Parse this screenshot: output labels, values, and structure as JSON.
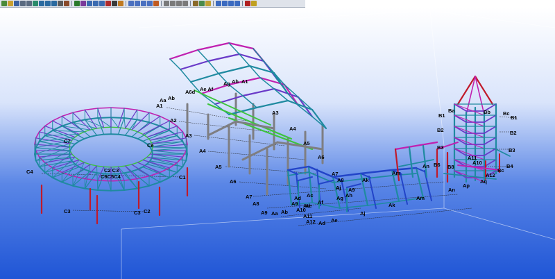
{
  "colors": {
    "bg_top": "#ffffff",
    "bg_bottom": "#1f55d6",
    "steel_teal": "#1f8aa0",
    "steel_magenta": "#c020b0",
    "steel_green": "#3cc43c",
    "steel_red": "#c01a2a",
    "steel_purple": "#6a3ac8",
    "steel_blue": "#2244c8",
    "column_gray": "#7e7e82",
    "gridline": "#1a1a1a"
  },
  "toolbar": {
    "buttons": [
      {
        "icon": "new-icon",
        "color": "#4a8a3a"
      },
      {
        "icon": "open-icon",
        "color": "#c9a030"
      },
      {
        "icon": "save-icon",
        "color": "#3a60a0"
      },
      {
        "icon": "undo-icon",
        "color": "#5a6a80"
      },
      {
        "icon": "redo-icon",
        "color": "#5a6a80"
      },
      {
        "icon": "grid-icon",
        "color": "#2a8a6a"
      },
      {
        "icon": "beam-icon",
        "color": "#2a6aa0"
      },
      {
        "icon": "column-icon",
        "color": "#2a6aa0"
      },
      {
        "icon": "plate-icon",
        "color": "#2a6aa0"
      },
      {
        "icon": "bolt-icon",
        "color": "#5a5a5a"
      },
      {
        "icon": "weld-icon",
        "color": "#8a4a2a"
      },
      {
        "icon": "separator",
        "color": ""
      },
      {
        "icon": "home-icon",
        "color": "#2a7a2a"
      },
      {
        "icon": "move-icon",
        "color": "#7a3a9a"
      },
      {
        "icon": "copy-icon",
        "color": "#3a6ab0"
      },
      {
        "icon": "rotate-icon",
        "color": "#3a6ab0"
      },
      {
        "icon": "mirror-icon",
        "color": "#3a6ab0"
      },
      {
        "icon": "delete-icon",
        "color": "#b02a2a"
      },
      {
        "icon": "select-icon",
        "color": "#3a3a3a"
      },
      {
        "icon": "measure-icon",
        "color": "#c07a20"
      },
      {
        "icon": "separator",
        "color": ""
      },
      {
        "icon": "view-icon",
        "color": "#4a70c0"
      },
      {
        "icon": "zoom-icon",
        "color": "#4a70c0"
      },
      {
        "icon": "pan-icon",
        "color": "#4a70c0"
      },
      {
        "icon": "fit-icon",
        "color": "#4a70c0"
      },
      {
        "icon": "render-icon",
        "color": "#c05a20"
      },
      {
        "icon": "separator",
        "color": ""
      },
      {
        "icon": "snap-icon",
        "color": "#7a7a7a"
      },
      {
        "icon": "point-icon",
        "color": "#7a7a7a"
      },
      {
        "icon": "line-icon",
        "color": "#7a7a7a"
      },
      {
        "icon": "arc-icon",
        "color": "#7a7a7a"
      },
      {
        "icon": "separator",
        "color": ""
      },
      {
        "icon": "link-icon",
        "color": "#8a6a2a"
      },
      {
        "icon": "layers-icon",
        "color": "#4a8a4a"
      },
      {
        "icon": "filter-icon",
        "color": "#c0a030"
      },
      {
        "icon": "separator",
        "color": ""
      },
      {
        "icon": "line-tool-icon",
        "color": "#3a6ac0"
      },
      {
        "icon": "polyline-icon",
        "color": "#3a6ac0"
      },
      {
        "icon": "pencil-icon",
        "color": "#3a6ac0"
      },
      {
        "icon": "erase-icon",
        "color": "#3a6ac0"
      },
      {
        "icon": "separator",
        "color": ""
      },
      {
        "icon": "arrow-icon",
        "color": "#b02020"
      },
      {
        "icon": "flag-icon",
        "color": "#c0a020"
      }
    ]
  },
  "labels": {
    "ring": {
      "c1": "C1",
      "c2": "C2",
      "c2b": "C2",
      "c3": "C3",
      "c3b": "C3",
      "c3c": "C3",
      "c4": "C4",
      "cc_top": "C7",
      "cc_ce": "Ce",
      "cc_mid": "C2 C3",
      "cc_mid2": "C6C5C4"
    },
    "mid": {
      "a1": "A1",
      "a2": "A2",
      "a3": "A3",
      "a4": "A4",
      "a5": "A5",
      "a6": "A6",
      "a6r": "A6",
      "a7": "A7",
      "a8": "A8",
      "a9": "A9",
      "aa": "Aa",
      "ab": "Ab",
      "aa2": "Aa",
      "ab2": "Ab",
      "a6c": "A6d",
      "aef": "Ae Af",
      "ag": "Ag",
      "ah": "Ah",
      "ai": "A1",
      "a1m": "A1",
      "a3m": "A3",
      "a4m": "A4",
      "a5m": "A5"
    },
    "low": {
      "a7": "A7",
      "a8": "A8",
      "a9": "A9",
      "a10": "A10",
      "a11": "A11",
      "a12": "A12",
      "ac": "Ac",
      "ad": "Ad",
      "ad2": "Ad",
      "ae": "Ae",
      "af": "Af",
      "ag": "Ag",
      "ah": "Ah",
      "ai": "Ai",
      "aj": "Aj",
      "ak": "Ak",
      "ak2": "Ak",
      "aj2": "Aj",
      "am": "Am",
      "am2": "Am",
      "a9b": "A9",
      "a8b": "A8",
      "ae2": "Ae",
      "ad3": "Ad",
      "aa3": "Aa",
      "ab3": "Ab"
    },
    "right": {
      "b1": "B1",
      "b2": "B2",
      "b3": "B3",
      "b4": "B4",
      "b1r": "B1",
      "b2r": "B2",
      "b3r": "B3",
      "ba": "Ba",
      "bc": "Bc",
      "bb": "Bb",
      "bc2": "Bc",
      "an": "An",
      "an2": "An",
      "ap": "Ap",
      "aq": "Aq",
      "a12": "A12",
      "a10": "A10",
      "bs": "B6",
      "bm": "B8",
      "b11": "A11"
    }
  }
}
